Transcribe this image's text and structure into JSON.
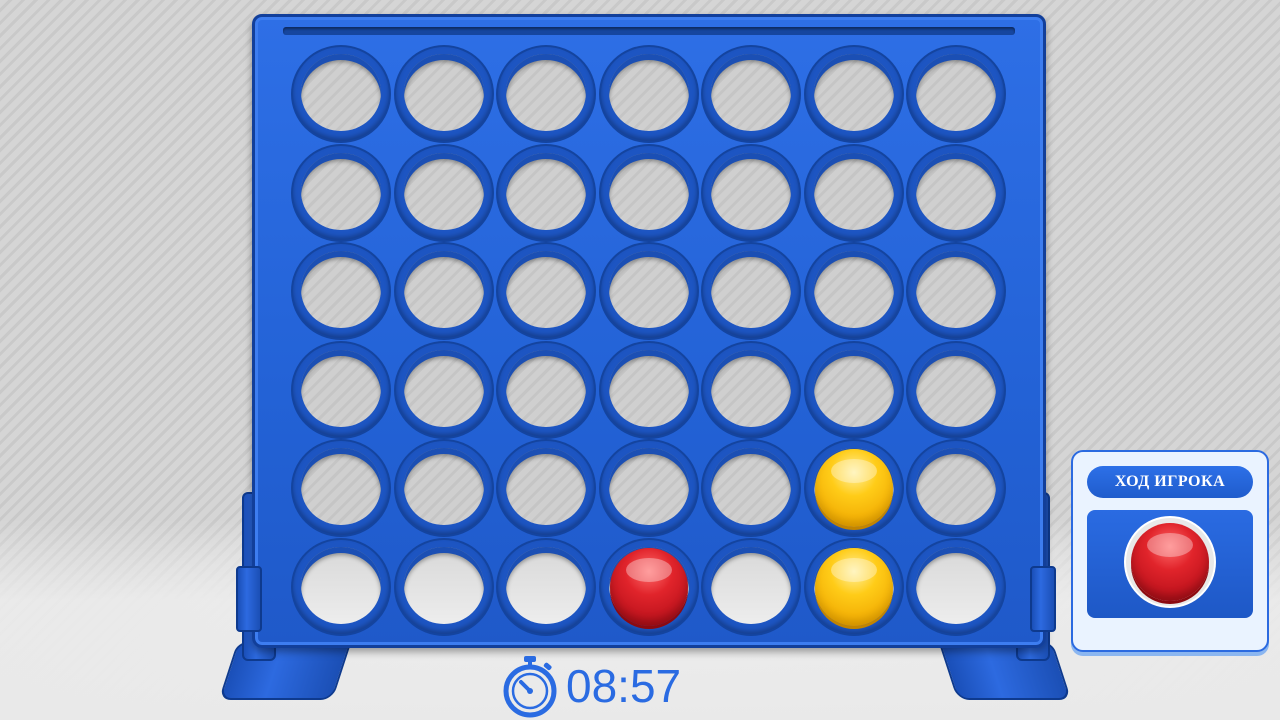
{
  "board": {
    "columns": 7,
    "rows": 6,
    "cells": [
      [
        "empty",
        "empty",
        "empty",
        "empty",
        "empty",
        "empty",
        "empty"
      ],
      [
        "empty",
        "empty",
        "empty",
        "empty",
        "empty",
        "empty",
        "empty"
      ],
      [
        "empty",
        "empty",
        "empty",
        "empty",
        "empty",
        "empty",
        "empty"
      ],
      [
        "empty",
        "empty",
        "empty",
        "empty",
        "empty",
        "empty",
        "empty"
      ],
      [
        "empty",
        "empty",
        "empty",
        "empty",
        "empty",
        "yellow",
        "empty"
      ],
      [
        "empty",
        "empty",
        "empty",
        "red",
        "empty",
        "yellow",
        "empty"
      ]
    ],
    "colors": {
      "board": "#2362d6",
      "red": "#e1242b",
      "yellow": "#ffcc18"
    }
  },
  "turn": {
    "label": "ХОД ИГРОКА",
    "current_player_color": "red"
  },
  "timer": {
    "icon": "stopwatch-icon",
    "value": "08:57"
  }
}
